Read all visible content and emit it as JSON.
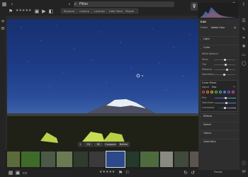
{
  "toolbar": {
    "search_text": "Filter",
    "funnel_icon": "filter-icon",
    "filters": [
      {
        "label": "Keyword"
      },
      {
        "label": "Camera"
      },
      {
        "label": "Location"
      },
      {
        "label": "Date Taken"
      },
      {
        "label": "People"
      }
    ]
  },
  "right_panel": {
    "edit_title": "Edit",
    "profile_label": "Profile",
    "profile_value": "Adobe Color",
    "sections": [
      "Light",
      "Color",
      "Effects",
      "Detail",
      "Optics",
      "Geometry"
    ],
    "color_rows": [
      "White Balance",
      "Temp",
      "Tint",
      "Vibrance",
      "Saturation"
    ],
    "color_mixer_title": "Color Mixer",
    "color_mixer_sub": "Adjust",
    "color_mixer_mode": "Hue",
    "hue_label": "Hue",
    "saturation_label": "Saturation",
    "luminance_label": "Luminance",
    "swatches": [
      "#e05050",
      "#e08a3a",
      "#d9c13a",
      "#6cc24a",
      "#3fc0c0",
      "#4a7de0",
      "#9a5ad0",
      "#d05ab8"
    ],
    "presets_label": "Presets"
  },
  "view_tools": {
    "buttons": [
      "Fit",
      "Fill",
      "Compare",
      "Before"
    ]
  },
  "bottom": {
    "zoom": "Fit"
  },
  "colors": {
    "accent": "#4a7de0",
    "panel": "#2e2e2e",
    "bar": "#232323"
  }
}
